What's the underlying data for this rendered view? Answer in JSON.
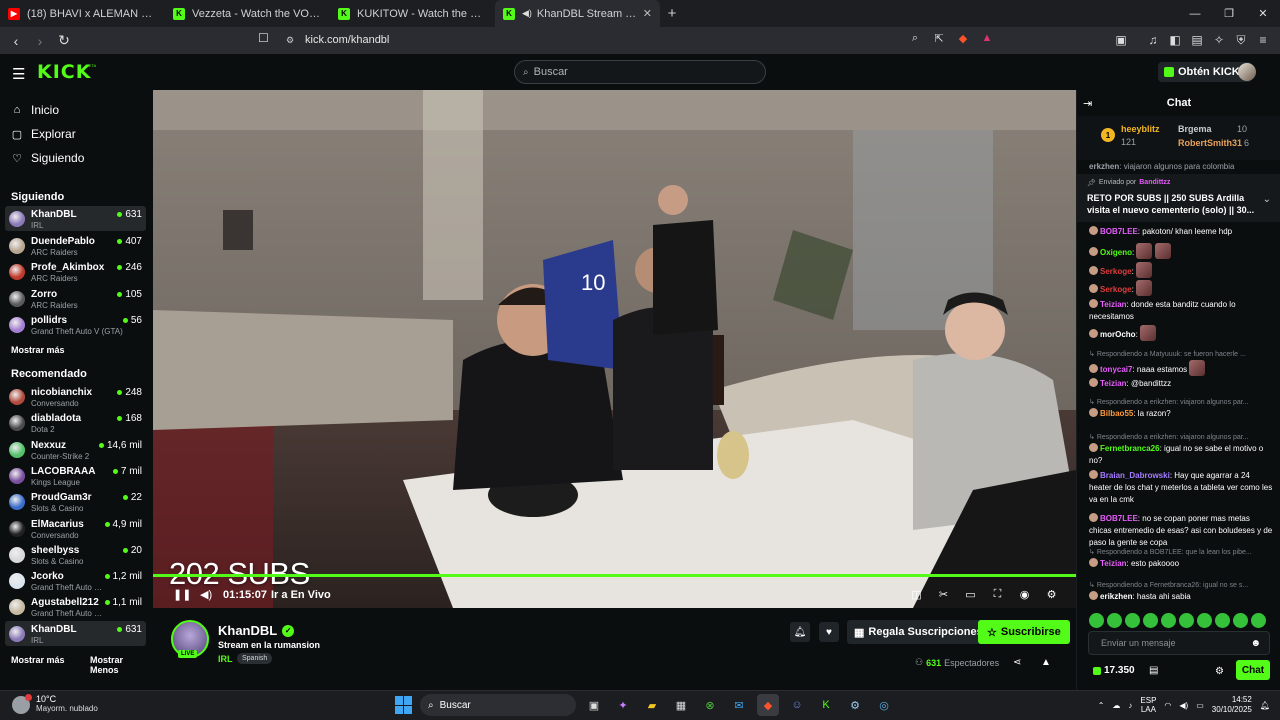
{
  "browser": {
    "tabs": [
      {
        "title": "(18) BHAVI x ALEMAN x NEO PISTEA",
        "icon": "youtube-icon",
        "color": "#ff0000"
      },
      {
        "title": "Vezzeta - Watch the VOD on Kick",
        "icon": "kick-icon",
        "color": "#53fc18"
      },
      {
        "title": "KUKITOW - Watch the VOD on Kick",
        "icon": "kick-icon",
        "color": "#53fc18"
      },
      {
        "title": "KhanDBL Stream - Watch Live o",
        "icon": "kick-icon",
        "color": "#53fc18"
      }
    ],
    "url": "kick.com/khandbl",
    "new_tab": "+",
    "close_tab": "✕"
  },
  "header": {
    "logo": "KICK",
    "beta": "BETA",
    "search_placeholder": "Buscar",
    "kicks_button": "Obtén KICKs"
  },
  "sidebar": {
    "nav": [
      {
        "label": "Inicio",
        "icon": "home-icon"
      },
      {
        "label": "Explorar",
        "icon": "explore-icon"
      },
      {
        "label": "Siguiendo",
        "icon": "heart-icon"
      }
    ],
    "following_title": "Siguiendo",
    "following": [
      {
        "name": "KhanDBL",
        "category": "IRL",
        "viewers": "631",
        "color": "#8c7ab8"
      },
      {
        "name": "DuendePablo",
        "category": "ARC Raiders",
        "viewers": "407",
        "color": "#b8a590"
      },
      {
        "name": "Profe_Akimbox",
        "category": "ARC Raiders",
        "viewers": "246",
        "color": "#c0392b"
      },
      {
        "name": "Zorro",
        "category": "ARC Raiders",
        "viewers": "105",
        "color": "#5a5a5a"
      },
      {
        "name": "pollidrs",
        "category": "Grand Theft Auto V (GTA)",
        "viewers": "56",
        "color": "#a47fd1"
      }
    ],
    "show_more": "Mostrar más",
    "recommended_title": "Recomendado",
    "recommended": [
      {
        "name": "nicobianchix",
        "category": "Conversando",
        "viewers": "248",
        "color": "#b04a3c"
      },
      {
        "name": "diabladota",
        "category": "Dota 2",
        "viewers": "168",
        "color": "#4a4a4a"
      },
      {
        "name": "Nexxuz",
        "category": "Counter-Strike 2",
        "viewers": "14,6 mil",
        "color": "#55c26a"
      },
      {
        "name": "LACOBRAAA",
        "category": "Kings League",
        "viewers": "7 mil",
        "color": "#7a4fa0"
      },
      {
        "name": "ProudGam3r",
        "category": "Slots & Casino",
        "viewers": "22",
        "color": "#3b6ec9"
      },
      {
        "name": "ElMacarius",
        "category": "Conversando",
        "viewers": "4,9 mil",
        "color": "#222222"
      },
      {
        "name": "sheelbyss",
        "category": "Slots & Casino",
        "viewers": "20",
        "color": "#d8d8d8"
      },
      {
        "name": "Jcorko",
        "category": "Grand Theft Auto V...",
        "viewers": "1,2 mil",
        "color": "#d9e4ef"
      },
      {
        "name": "Agustabell212",
        "category": "Grand Theft Auto V...",
        "viewers": "1,1 mil",
        "color": "#c5b9a0"
      },
      {
        "name": "KhanDBL",
        "category": "IRL",
        "viewers": "631",
        "color": "#8c7ab8"
      }
    ],
    "show_more2": "Mostrar más",
    "show_less": "Mostrar Menos"
  },
  "player": {
    "overlay": "202 SUBS",
    "time": "01:15:07",
    "go_live": "Ir a En Vivo",
    "progress": 1.0
  },
  "stream": {
    "live_badge": "LIVE",
    "name": "KhanDBL",
    "title": "Stream en la rumansion",
    "category": "IRL",
    "language": "Spanish",
    "gift_button": "Regala Suscripciones",
    "subscribe_button": "Suscribirse",
    "viewers": "631",
    "viewers_label": "Espectadores"
  },
  "chat": {
    "title": "Chat",
    "leaderboard": {
      "rank": "1",
      "first_name": "heeyblitz",
      "first_count": "121",
      "second_name": "Brgema",
      "second_count": "10",
      "third_name": "RobertSmith31",
      "third_count": "6"
    },
    "cut_msg_user": "erkzhen",
    "cut_msg_text": "viajaron algunos para colombia",
    "pinned_by": "Enviado por",
    "pinned_user": "Bandittzz",
    "pinned_text": "RETO POR SUBS || 250 SUBS Ardilla visita el nuevo cementerio (solo) || 30...",
    "messages": [
      {
        "user": "BOB7LEE",
        "text": "pakoton/ khan leeme hdp",
        "color": "#e85bfd"
      },
      {
        "user": "Oxigeno",
        "text": "",
        "color": "#53fc18"
      },
      {
        "user": "Serkoge",
        "text": "",
        "color": "#e03c3c"
      },
      {
        "user": "Serkoge",
        "text": "",
        "color": "#e03c3c"
      },
      {
        "user": "Teizian",
        "text": "donde esta banditz cuando lo necesitamos",
        "color": "#e85bfd"
      },
      {
        "user": "morOcho",
        "text": "",
        "color": "#ffffff"
      },
      {
        "reply": "Respondiendo a Matyuuuk: se fueron hacerle ..."
      },
      {
        "user": "tonycai7",
        "text": "naaa estamos",
        "color": "#e85bfd"
      },
      {
        "user": "Teizian",
        "text": "@bandittzz",
        "color": "#e85bfd"
      },
      {
        "reply": "Respondiendo a erikzhen: viajaron algunos par..."
      },
      {
        "user": "Bilbao55",
        "text": "la razon?",
        "color": "#ff9a3c"
      },
      {
        "reply": "Respondiendo a erikzhen: viajaron algunos par..."
      },
      {
        "user": "Fernetbranca26",
        "text": "igual no se sabe el motivo o no?",
        "color": "#53fc18"
      },
      {
        "user": "Braian_Dabrowski",
        "text": "Hay que agarrar a 24 heater de los chat y meterlos a tableta ver como les va en la cmk",
        "color": "#a67cff"
      },
      {
        "user": "BOB7LEE",
        "text": "no se copan poner mas metas chicas entremedio de esas? asi con boludeses y de paso la gente se copa",
        "color": "#e85bfd"
      },
      {
        "reply": "Respondiendo a BOB7LEE: que la lean los pibe..."
      },
      {
        "user": "Teizian",
        "text": "esto pakoooo",
        "color": "#e85bfd"
      },
      {
        "reply": "Respondiendo a Fernetbranca26: igual no se s..."
      },
      {
        "user": "erikzhen",
        "text": "hasta ahi sabia",
        "color": "#ffffff"
      }
    ],
    "input_placeholder": "Enviar un mensaje",
    "kicks_balance": "17.350",
    "send_button": "Chat"
  },
  "taskbar": {
    "temp": "10°C",
    "weather": "Mayorm. nublado",
    "search": "Buscar",
    "lang1": "ESP",
    "lang2": "LAA",
    "time": "14:52",
    "date": "30/10/2025"
  },
  "colors": {
    "brand": "#53fc18",
    "bg": "#0b0e0f"
  }
}
